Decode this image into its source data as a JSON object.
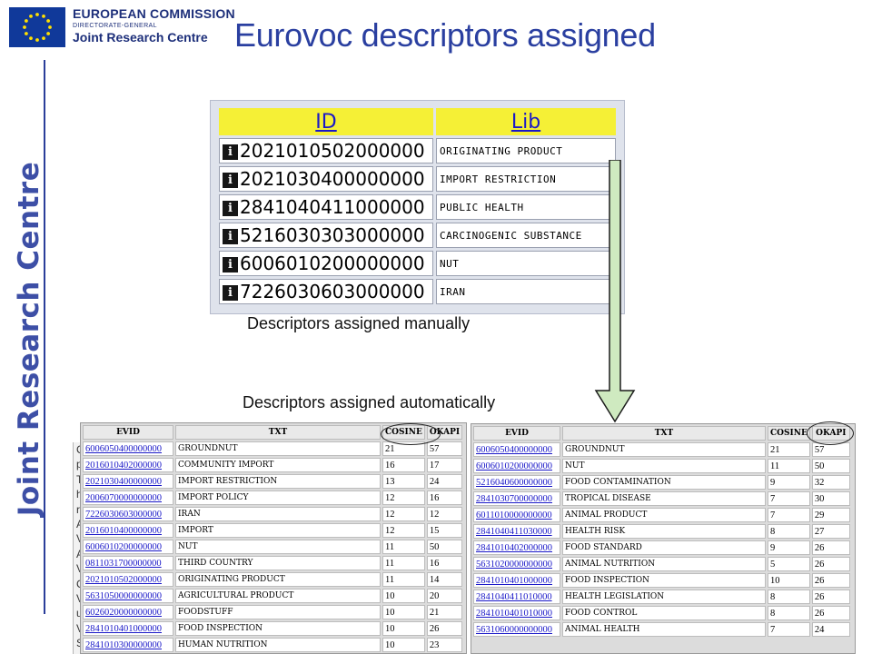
{
  "header": {
    "org_line1": "EUROPEAN COMMISSION",
    "org_line2": "DIRECTORATE-GENERAL",
    "org_line3": "Joint Research Centre",
    "slide_title": "Eurovoc descriptors assigned"
  },
  "side_brand": "Joint Research Centre",
  "manual": {
    "caption": "Descriptors assigned manually",
    "headers": {
      "id": "ID",
      "lib": "Lib"
    },
    "rows": [
      {
        "id": "2021010502000000",
        "lib": "ORIGINATING PRODUCT"
      },
      {
        "id": "2021030400000000",
        "lib": "IMPORT RESTRICTION"
      },
      {
        "id": "2841040411000000",
        "lib": "PUBLIC HEALTH"
      },
      {
        "id": "5216030303000000",
        "lib": "CARCINOGENIC SUBSTANCE"
      },
      {
        "id": "6006010200000000",
        "lib": "NUT"
      },
      {
        "id": "7226030603000000",
        "lib": "IRAN"
      }
    ]
  },
  "auto": {
    "caption": "Descriptors assigned automatically",
    "headers": {
      "evid": "EVID",
      "txt": "TXT",
      "cosine": "COSINE",
      "okapi": "OKAPI"
    },
    "left_rows": [
      {
        "evid": "6006050400000000",
        "txt": "GROUNDNUT",
        "cosine": "21",
        "okapi": "57"
      },
      {
        "evid": "2016010402000000",
        "txt": "COMMUNITY IMPORT",
        "cosine": "16",
        "okapi": "17"
      },
      {
        "evid": "2021030400000000",
        "txt": "IMPORT RESTRICTION",
        "cosine": "13",
        "okapi": "24"
      },
      {
        "evid": "2006070000000000",
        "txt": "IMPORT POLICY",
        "cosine": "12",
        "okapi": "16"
      },
      {
        "evid": "7226030603000000",
        "txt": "IRAN",
        "cosine": "12",
        "okapi": "12"
      },
      {
        "evid": "2016010400000000",
        "txt": "IMPORT",
        "cosine": "12",
        "okapi": "15"
      },
      {
        "evid": "6006010200000000",
        "txt": "NUT",
        "cosine": "11",
        "okapi": "50"
      },
      {
        "evid": "0811031700000000",
        "txt": "THIRD COUNTRY",
        "cosine": "11",
        "okapi": "16"
      },
      {
        "evid": "2021010502000000",
        "txt": "ORIGINATING PRODUCT",
        "cosine": "11",
        "okapi": "14"
      },
      {
        "evid": "5631050000000000",
        "txt": "AGRICULTURAL PRODUCT",
        "cosine": "10",
        "okapi": "20"
      },
      {
        "evid": "6026020000000000",
        "txt": "FOODSTUFF",
        "cosine": "10",
        "okapi": "21"
      },
      {
        "evid": "2841010401000000",
        "txt": "FOOD INSPECTION",
        "cosine": "10",
        "okapi": "26"
      },
      {
        "evid": "2841010300000000",
        "txt": "HUMAN NUTRITION",
        "cosine": "10",
        "okapi": "23"
      }
    ],
    "right_rows": [
      {
        "evid": "6006050400000000",
        "txt": "GROUNDNUT",
        "cosine": "21",
        "okapi": "57"
      },
      {
        "evid": "6006010200000000",
        "txt": "NUT",
        "cosine": "11",
        "okapi": "50"
      },
      {
        "evid": "5216040600000000",
        "txt": "FOOD CONTAMINATION",
        "cosine": "9",
        "okapi": "32"
      },
      {
        "evid": "2841030700000000",
        "txt": "TROPICAL DISEASE",
        "cosine": "7",
        "okapi": "30"
      },
      {
        "evid": "6011010000000000",
        "txt": "ANIMAL PRODUCT",
        "cosine": "7",
        "okapi": "29"
      },
      {
        "evid": "2841040411030000",
        "txt": "HEALTH RISK",
        "cosine": "8",
        "okapi": "27"
      },
      {
        "evid": "2841010402000000",
        "txt": "FOOD STANDARD",
        "cosine": "9",
        "okapi": "26"
      },
      {
        "evid": "5631020000000000",
        "txt": "ANIMAL NUTRITION",
        "cosine": "5",
        "okapi": "26"
      },
      {
        "evid": "2841010401000000",
        "txt": "FOOD INSPECTION",
        "cosine": "10",
        "okapi": "26"
      },
      {
        "evid": "2841040411010000",
        "txt": "HEALTH LEGISLATION",
        "cosine": "8",
        "okapi": "26"
      },
      {
        "evid": "2841010401010000",
        "txt": "FOOD CONTROL",
        "cosine": "8",
        "okapi": "26"
      },
      {
        "evid": "5631060000000000",
        "txt": "ANIMAL HEALTH",
        "cosine": "7",
        "okapi": "24"
      }
    ]
  },
  "colors": {
    "title_blue": "#2a3fa0",
    "header_yellow": "#f5f036",
    "link_blue": "#1a18c8",
    "arrow_green": "#cfeac0"
  },
  "icons": {
    "eu_flag": "eu-flag-icon",
    "info": "info-icon",
    "arrow": "down-arrow-icon"
  },
  "ghost_letters": [
    "C",
    "p",
    "T",
    "h",
    "r",
    "A",
    "V",
    "A",
    "V",
    "C",
    "V",
    "u",
    "V",
    "S"
  ]
}
